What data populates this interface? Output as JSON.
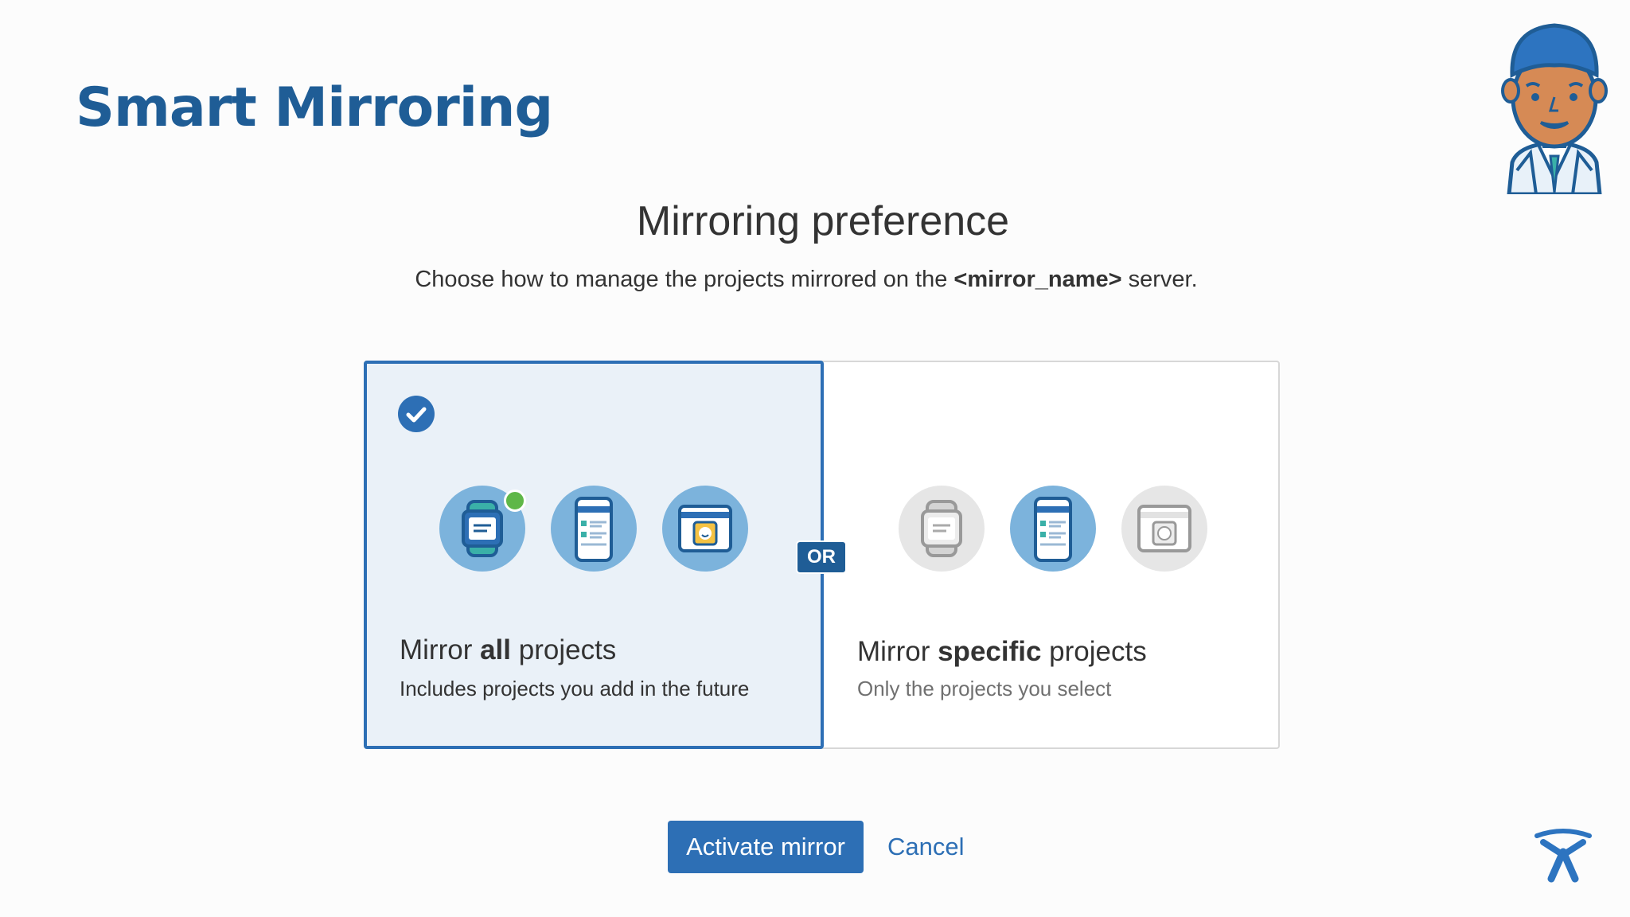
{
  "slide": {
    "title": "Smart Mirroring"
  },
  "dialog": {
    "heading": "Mirroring preference",
    "description_pre": "Choose how to manage the projects mirrored on the ",
    "description_bold": "<mirror_name>",
    "description_post": " server."
  },
  "options": [
    {
      "selected": true,
      "title_pre": "Mirror ",
      "title_bold": "all",
      "title_post": " projects",
      "description": "Includes projects you add in the future",
      "icons": [
        "watch-icon",
        "phone-icon",
        "tablet-icon"
      ]
    },
    {
      "selected": false,
      "title_pre": "Mirror ",
      "title_bold": "specific",
      "title_post": " projects",
      "description": "Only the projects you select",
      "icons": [
        "watch-icon",
        "phone-icon",
        "tablet-icon"
      ]
    }
  ],
  "separator": "OR",
  "actions": {
    "primary": "Activate mirror",
    "secondary": "Cancel"
  },
  "colors": {
    "title": "#1f5d96",
    "accent": "#2d6fb5",
    "selected_bg": "#eaf1f8",
    "icon_active": "#7cb3dc",
    "icon_inactive": "#e6e6e6",
    "status_dot": "#5fb748"
  }
}
